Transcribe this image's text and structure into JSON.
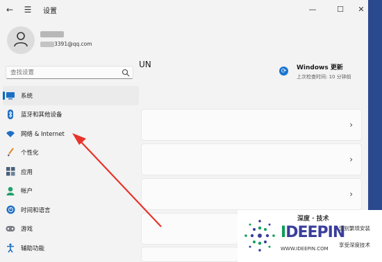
{
  "titlebar": {
    "back": "←",
    "menu": "☰",
    "title": "设置",
    "minimize": "—",
    "maximize": "☐",
    "close": "✕"
  },
  "profile": {
    "email": "3391@qq.com"
  },
  "search": {
    "placeholder": "查找设置"
  },
  "sidebar": {
    "items": [
      {
        "label": "系统",
        "icon": "system-icon",
        "active": true
      },
      {
        "label": "蓝牙和其他设备",
        "icon": "bluetooth-icon"
      },
      {
        "label": "网络 & Internet",
        "icon": "wifi-icon"
      },
      {
        "label": "个性化",
        "icon": "brush-icon"
      },
      {
        "label": "应用",
        "icon": "apps-icon"
      },
      {
        "label": "帐户",
        "icon": "account-icon"
      },
      {
        "label": "时间和语言",
        "icon": "globe-icon"
      },
      {
        "label": "游戏",
        "icon": "gamepad-icon"
      },
      {
        "label": "辅助功能",
        "icon": "accessibility-icon"
      }
    ]
  },
  "main": {
    "title_fragment": "UN",
    "update": {
      "title": "Windows 更新",
      "subtitle": "上次检查时间: 10 分钟前"
    },
    "cards": [
      {
        "chevron": "›"
      },
      {
        "chevron": "›"
      },
      {
        "chevron": "›"
      }
    ]
  },
  "watermark": {
    "brand_prefix": "I",
    "brand_rest": "DEEPIN",
    "cn_name": "深度 · 技术",
    "url": "WWW.IDEEPIN.COM",
    "tagline1": "告别繁琐安装",
    "tagline2": "享受深度技术"
  },
  "colors": {
    "accent": "#0067c0",
    "arrow": "#e8332a",
    "brand": "#3a3f9b"
  }
}
